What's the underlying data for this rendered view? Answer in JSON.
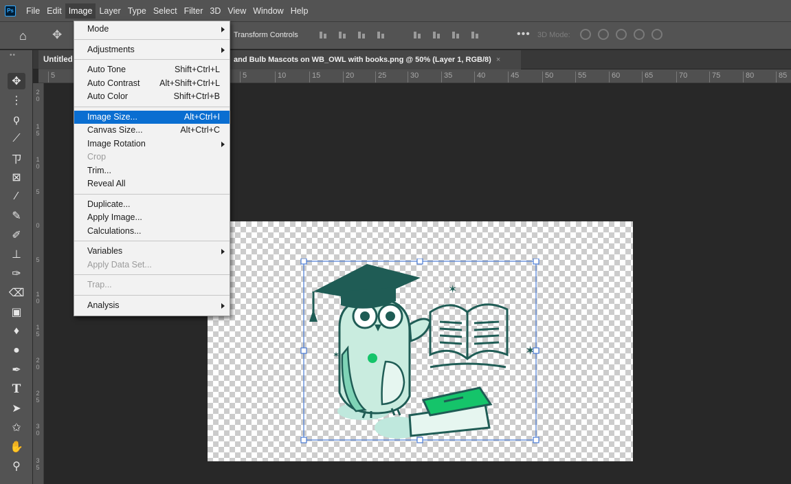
{
  "menubar": {
    "logo": "Ps",
    "items": [
      "File",
      "Edit",
      "Image",
      "Layer",
      "Type",
      "Select",
      "Filter",
      "3D",
      "View",
      "Window",
      "Help"
    ],
    "active_index": 2
  },
  "options_bar": {
    "transform_controls_label": "Transform Controls",
    "more_label": "•••",
    "mode3d_label": "3D Mode:"
  },
  "tabs": {
    "first_label": "Untitled",
    "active_label": "and Bulb Mascots on WB_OWL with books.png @ 50% (Layer 1, RGB/8)",
    "close_glyph": "×",
    "grip": "••"
  },
  "ruler": {
    "h_ticks": [
      "5",
      "5",
      "10",
      "15",
      "20",
      "25",
      "30",
      "35",
      "40",
      "45",
      "50",
      "55",
      "60",
      "65",
      "70",
      "75",
      "80",
      "85"
    ],
    "v_ticks": [
      "2",
      "0",
      "1",
      "5",
      "1",
      "0",
      "5",
      "0",
      "5",
      "1",
      "0",
      "1",
      "5",
      "2",
      "0",
      "2",
      "5",
      "3",
      "0",
      "3",
      "5"
    ]
  },
  "image_menu": {
    "items": [
      {
        "label": "Mode",
        "submenu": true
      },
      {
        "separator": true
      },
      {
        "label": "Adjustments",
        "submenu": true
      },
      {
        "separator": true
      },
      {
        "label": "Auto Tone",
        "shortcut": "Shift+Ctrl+L"
      },
      {
        "label": "Auto Contrast",
        "shortcut": "Alt+Shift+Ctrl+L"
      },
      {
        "label": "Auto Color",
        "shortcut": "Shift+Ctrl+B"
      },
      {
        "separator": true
      },
      {
        "label": "Image Size...",
        "shortcut": "Alt+Ctrl+I",
        "highlighted": true
      },
      {
        "label": "Canvas Size...",
        "shortcut": "Alt+Ctrl+C"
      },
      {
        "label": "Image Rotation",
        "submenu": true
      },
      {
        "label": "Crop",
        "disabled": true
      },
      {
        "label": "Trim..."
      },
      {
        "label": "Reveal All"
      },
      {
        "separator": true
      },
      {
        "label": "Duplicate..."
      },
      {
        "label": "Apply Image..."
      },
      {
        "label": "Calculations..."
      },
      {
        "separator": true
      },
      {
        "label": "Variables",
        "submenu": true
      },
      {
        "label": "Apply Data Set...",
        "disabled": true
      },
      {
        "separator": true
      },
      {
        "label": "Trap...",
        "disabled": true
      },
      {
        "separator": true
      },
      {
        "label": "Analysis",
        "submenu": true
      }
    ]
  },
  "toolbar": {
    "tools": [
      {
        "name": "move-tool-icon",
        "glyph": "✥",
        "selected": true
      },
      {
        "name": "marquee-tool-icon",
        "glyph": "⋮"
      },
      {
        "name": "lasso-tool-icon",
        "glyph": "ϙ"
      },
      {
        "name": "quick-selection-tool-icon",
        "glyph": "⟋"
      },
      {
        "name": "crop-tool-icon",
        "glyph": "ㄗ"
      },
      {
        "name": "frame-tool-icon",
        "glyph": "⊠"
      },
      {
        "name": "eyedropper-tool-icon",
        "glyph": "⁄"
      },
      {
        "name": "healing-brush-tool-icon",
        "glyph": "✎"
      },
      {
        "name": "brush-tool-icon",
        "glyph": "✐"
      },
      {
        "name": "clone-stamp-tool-icon",
        "glyph": "⊥"
      },
      {
        "name": "history-brush-tool-icon",
        "glyph": "✑"
      },
      {
        "name": "eraser-tool-icon",
        "glyph": "⌫"
      },
      {
        "name": "gradient-tool-icon",
        "glyph": "▣"
      },
      {
        "name": "blur-tool-icon",
        "glyph": "♦"
      },
      {
        "name": "dodge-tool-icon",
        "glyph": "●"
      },
      {
        "name": "pen-tool-icon",
        "glyph": "✒"
      },
      {
        "name": "type-tool-icon",
        "glyph": "T"
      },
      {
        "name": "path-selection-tool-icon",
        "glyph": "➤"
      },
      {
        "name": "shape-tool-icon",
        "glyph": "✩"
      },
      {
        "name": "hand-tool-icon",
        "glyph": "✋"
      },
      {
        "name": "zoom-tool-icon",
        "glyph": "⚲"
      }
    ]
  },
  "colors": {
    "menu_highlight": "#0a6ed1",
    "panel_bg": "#535353",
    "workspace_bg": "#282828",
    "selection_handle": "#4a7bd4",
    "art_teal": "#1f5c55",
    "art_green": "#15c46a",
    "art_mint": "#bfe8dd"
  }
}
